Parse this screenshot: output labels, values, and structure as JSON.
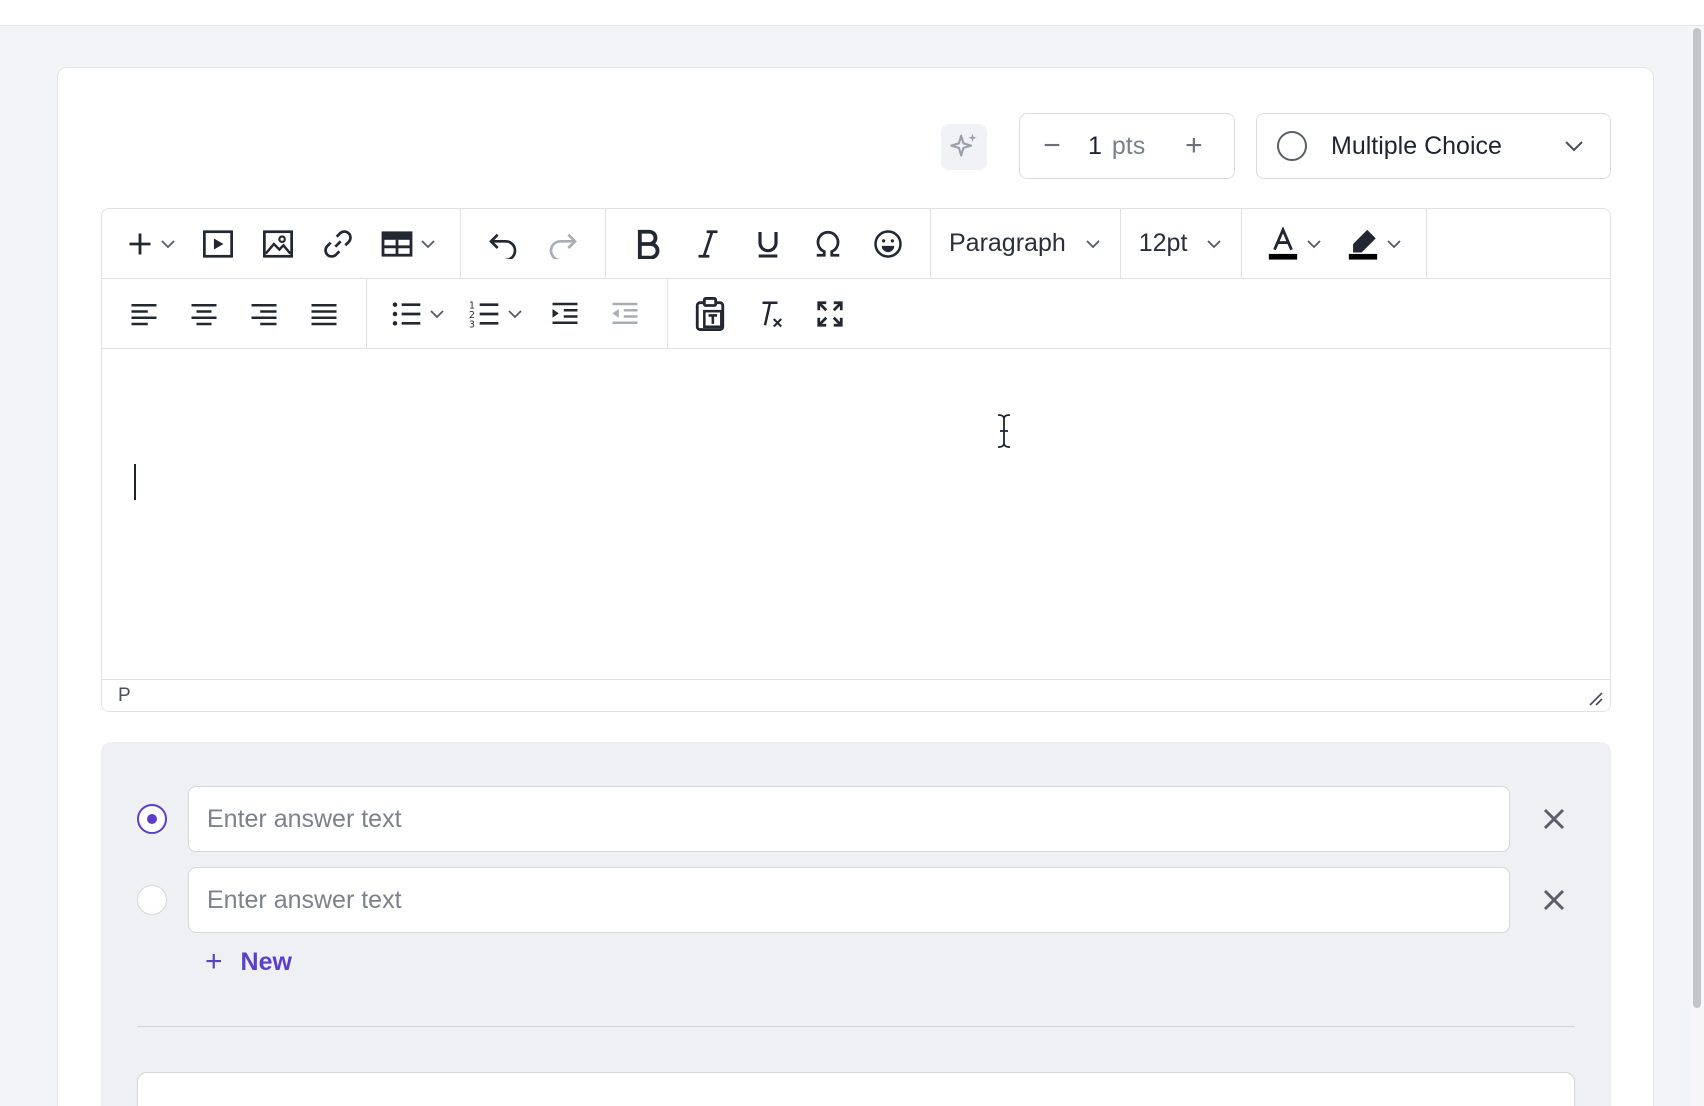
{
  "points": {
    "value": "1",
    "unit": "pts",
    "decrement": "−",
    "increment": "+"
  },
  "question_type": {
    "label": "Multiple Choice"
  },
  "toolbar": {
    "block_format": "Paragraph",
    "font_size": "12pt"
  },
  "editor": {
    "status_path": "P",
    "content": ""
  },
  "answers": [
    {
      "value": "",
      "placeholder": "Enter answer text",
      "selected": true
    },
    {
      "value": "",
      "placeholder": "Enter answer text",
      "selected": false
    }
  ],
  "new_answer": {
    "plus": "+",
    "label": "New"
  },
  "colors": {
    "accent": "#5b3fc8",
    "text_color_swatch": "#000000",
    "highlight_swatch": "#000000"
  }
}
